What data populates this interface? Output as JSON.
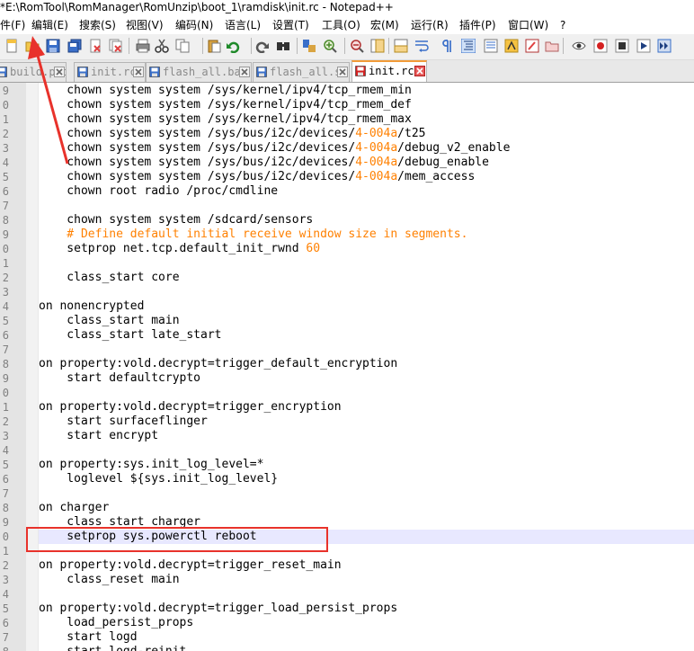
{
  "window": {
    "title": "*E:\\RomTool\\RomManager\\RomUnzip\\boot_1\\ramdisk\\init.rc - Notepad++"
  },
  "menu": [
    {
      "label": "件(F)"
    },
    {
      "label": "编辑(E)"
    },
    {
      "label": "搜索(S)"
    },
    {
      "label": "视图(V)"
    },
    {
      "label": "编码(N)"
    },
    {
      "label": "语言(L)"
    },
    {
      "label": "设置(T)"
    },
    {
      "label": "工具(O)"
    },
    {
      "label": "宏(M)"
    },
    {
      "label": "运行(R)"
    },
    {
      "label": "插件(P)"
    },
    {
      "label": "窗口(W)"
    },
    {
      "label": "?"
    }
  ],
  "toolbar_icons": [
    "new-file-icon",
    "open-file-icon",
    "save-icon",
    "save-all-icon",
    "close-icon",
    "close-all-icon",
    "print-icon",
    "cut-icon",
    "copy-icon",
    "paste-icon",
    "undo-icon",
    "redo-icon",
    "find-icon",
    "replace-icon",
    "zoom-in-icon",
    "zoom-out-icon",
    "sync-vertical-icon",
    "sync-horizontal-icon",
    "word-wrap-icon",
    "show-all-chars-icon",
    "indent-guide-icon",
    "document-map-icon",
    "function-list-icon",
    "folder-workspace-icon",
    "monitor-icon",
    "record-macro-icon",
    "stop-record-icon",
    "play-macro-icon",
    "run-macro-multiple-icon",
    "save-macro-icon"
  ],
  "tabs": [
    {
      "label": "build.prop",
      "active": false
    },
    {
      "label": "init.rc",
      "active": false
    },
    {
      "label": "flash_all.bat",
      "active": false
    },
    {
      "label": "flash_all.sh",
      "active": false
    },
    {
      "label": "init.rc",
      "active": true
    }
  ],
  "editor": {
    "line_numbers": [
      "9",
      "0",
      "1",
      "2",
      "3",
      "4",
      "5",
      "6",
      "7",
      "8",
      "9",
      "0",
      "1",
      "2",
      "3",
      "4",
      "5",
      "6",
      "7",
      "8",
      "9",
      "0",
      "1",
      "2",
      "3",
      "4",
      "5",
      "6",
      "7",
      "8",
      "9",
      "0",
      "1",
      "2",
      "3",
      "4",
      "5",
      "6",
      "7",
      "8"
    ],
    "lines": [
      [
        {
          "t": "    chown system system /sys/kernel/ipv4/tcp_rmem_min",
          "c": "plain"
        }
      ],
      [
        {
          "t": "    chown system system /sys/kernel/ipv4/tcp_rmem_def",
          "c": "plain"
        }
      ],
      [
        {
          "t": "    chown system system /sys/kernel/ipv4/tcp_rmem_max",
          "c": "plain"
        }
      ],
      [
        {
          "t": "    chown system system /sys/bus/i2c/devices/",
          "c": "plain"
        },
        {
          "t": "4-004a",
          "c": "num"
        },
        {
          "t": "/t25",
          "c": "plain"
        }
      ],
      [
        {
          "t": "    chown system system /sys/bus/i2c/devices/",
          "c": "plain"
        },
        {
          "t": "4-004a",
          "c": "num"
        },
        {
          "t": "/debug_v2_enable",
          "c": "plain"
        }
      ],
      [
        {
          "t": "    chown system system /sys/bus/i2c/devices/",
          "c": "plain"
        },
        {
          "t": "4-004a",
          "c": "num"
        },
        {
          "t": "/debug_enable",
          "c": "plain"
        }
      ],
      [
        {
          "t": "    chown system system /sys/bus/i2c/devices/",
          "c": "plain"
        },
        {
          "t": "4-004a",
          "c": "num"
        },
        {
          "t": "/mem_access",
          "c": "plain"
        }
      ],
      [
        {
          "t": "    chown root radio /proc/cmdline",
          "c": "plain"
        }
      ],
      [
        {
          "t": "",
          "c": "plain"
        }
      ],
      [
        {
          "t": "    chown system system /sdcard/sensors",
          "c": "plain"
        }
      ],
      [
        {
          "t": "    # Define default initial receive window size in segments.",
          "c": "com"
        }
      ],
      [
        {
          "t": "    setprop net.tcp.default_init_rwnd ",
          "c": "plain"
        },
        {
          "t": "60",
          "c": "num"
        }
      ],
      [
        {
          "t": "",
          "c": "plain"
        }
      ],
      [
        {
          "t": "    class_start core",
          "c": "plain"
        }
      ],
      [
        {
          "t": "",
          "c": "plain"
        }
      ],
      [
        {
          "t": "on nonencrypted",
          "c": "plain"
        }
      ],
      [
        {
          "t": "    class_start main",
          "c": "plain"
        }
      ],
      [
        {
          "t": "    class_start late_start",
          "c": "plain"
        }
      ],
      [
        {
          "t": "",
          "c": "plain"
        }
      ],
      [
        {
          "t": "on property:vold.decrypt=trigger_default_encryption",
          "c": "plain"
        }
      ],
      [
        {
          "t": "    start defaultcrypto",
          "c": "plain"
        }
      ],
      [
        {
          "t": "",
          "c": "plain"
        }
      ],
      [
        {
          "t": "on property:vold.decrypt=trigger_encryption",
          "c": "plain"
        }
      ],
      [
        {
          "t": "    start surfaceflinger",
          "c": "plain"
        }
      ],
      [
        {
          "t": "    start encrypt",
          "c": "plain"
        }
      ],
      [
        {
          "t": "",
          "c": "plain"
        }
      ],
      [
        {
          "t": "on property:sys.init_log_level=*",
          "c": "plain"
        }
      ],
      [
        {
          "t": "    loglevel ${sys.init_log_level}",
          "c": "plain"
        }
      ],
      [
        {
          "t": "",
          "c": "plain"
        }
      ],
      [
        {
          "t": "on charger",
          "c": "plain"
        }
      ],
      [
        {
          "t": "    class_start charger",
          "c": "plain"
        }
      ],
      [
        {
          "t": "    setprop sys.powerctl reboot",
          "c": "plain"
        }
      ],
      [
        {
          "t": "",
          "c": "plain"
        }
      ],
      [
        {
          "t": "on property:vold.decrypt=trigger_reset_main",
          "c": "plain"
        }
      ],
      [
        {
          "t": "    class_reset main",
          "c": "plain"
        }
      ],
      [
        {
          "t": "",
          "c": "plain"
        }
      ],
      [
        {
          "t": "on property:vold.decrypt=trigger_load_persist_props",
          "c": "plain"
        }
      ],
      [
        {
          "t": "    load_persist_props",
          "c": "plain"
        }
      ],
      [
        {
          "t": "    start logd",
          "c": "plain"
        }
      ],
      [
        {
          "t": "    start logd-reinit",
          "c": "plain"
        }
      ]
    ],
    "current_line_index": 31
  },
  "annotation": {
    "box_color": "#e8322b",
    "arrow_color": "#e8322b"
  }
}
